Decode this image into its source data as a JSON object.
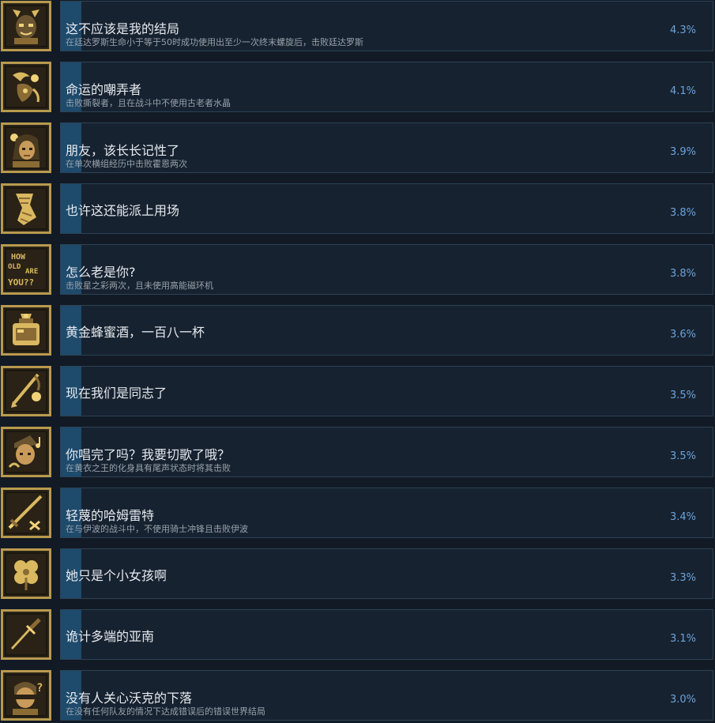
{
  "achievements": [
    {
      "title": "这不应该是我的结局",
      "description": "在廷达罗斯生命小于等于50时成功使用出至少一次终末螺旋后，击败廷达罗斯",
      "percent": "4.3%",
      "percent_value": 4.3,
      "icon": "portrait-horned-icon"
    },
    {
      "title": "命运的嘲弄者",
      "description": "击败撕裂者，且在战斗中不使用古老者水晶",
      "percent": "4.1%",
      "percent_value": 4.1,
      "icon": "tentacle-creature-icon"
    },
    {
      "title": "朋友，该长长记性了",
      "description": "在单次横组经历中击败霍恩两次",
      "percent": "3.9%",
      "percent_value": 3.9,
      "icon": "portrait-woman-icon"
    },
    {
      "title": "也许这还能派上用场",
      "description": "",
      "percent": "3.8%",
      "percent_value": 3.8,
      "icon": "bandage-icon"
    },
    {
      "title": "怎么老是你?",
      "description": "击败星之彩两次，且未使用高能磁环机",
      "percent": "3.8%",
      "percent_value": 3.8,
      "icon": "how-old-are-you-icon",
      "icon_text": [
        "HOW",
        "OLD",
        "ARE",
        "YOU??"
      ]
    },
    {
      "title": "黄金蜂蜜酒，一百八一杯",
      "description": "",
      "percent": "3.6%",
      "percent_value": 3.6,
      "icon": "mead-jar-icon"
    },
    {
      "title": "现在我们是同志了",
      "description": "",
      "percent": "3.5%",
      "percent_value": 3.5,
      "icon": "lute-icon"
    },
    {
      "title": "你唱完了吗？我要切歌了哦？",
      "description": "在黄衣之王的化身具有尾声状态时将其击败",
      "percent": "3.5%",
      "percent_value": 3.5,
      "icon": "singer-music-note-icon"
    },
    {
      "title": "轻蔑的哈姆雷特",
      "description": "在与伊波的战斗中，不使用骑士冲锋且击败伊波",
      "percent": "3.4%",
      "percent_value": 3.4,
      "icon": "sword-cross-icon"
    },
    {
      "title": "她只是个小女孩啊",
      "description": "",
      "percent": "3.3%",
      "percent_value": 3.3,
      "icon": "clover-icon"
    },
    {
      "title": "诡计多端的亚南",
      "description": "",
      "percent": "3.1%",
      "percent_value": 3.1,
      "icon": "dagger-icon"
    },
    {
      "title": "没有人关心沃克的下落",
      "description": "在没有任何队友的情况下达成错误后的错误世界结局",
      "percent": "3.0%",
      "percent_value": 3.0,
      "icon": "blindfolded-question-icon"
    }
  ]
}
